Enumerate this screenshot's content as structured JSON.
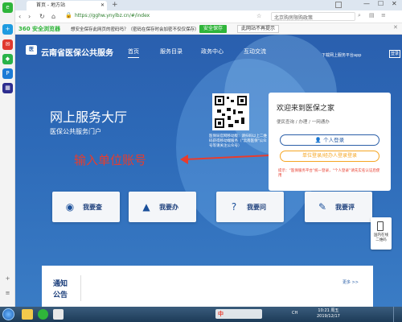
{
  "browser": {
    "tab_title": "首页 - 地方站",
    "new_tab": "+",
    "url": "https://gghw.ynylbz.cn/#/index",
    "search_placeholder": "北京购房限购政策",
    "brand": "360 安全浏览器",
    "infobar_text": "想安全保存此网页的密码吗？（密码在保存时会加密不仅仅保存）",
    "save_btn": "安全保存",
    "nosave_btn": "此网站不再提示",
    "win_min": "—",
    "win_max": "☐",
    "win_close": "✕"
  },
  "site": {
    "logo_text": "云南省医保公共服务",
    "nav": [
      "首页",
      "服务目录",
      "政务中心",
      "互动交流"
    ],
    "app_download": "下载网上服务平台app",
    "login_short": "登录",
    "hero_title": "网上服务大厅",
    "hero_sub": "医保公共服务门户",
    "qr_caption": "医保局官网移动版：请扫码以上二维码获得移动端服务（\"云南医保\"公众号等请关注公众号）",
    "annotation": "输入单位账号",
    "welcome_title": "欢迎来到医保之家",
    "welcome_sub": "便民查询 / 办理 / 一网通办",
    "personal_login": "个人登录",
    "unit_login": "单位登录/经办人登录登录",
    "hint": "提示：“医保服务平台”统一登录，“个人登录”请先实名认证后使用"
  },
  "services": [
    {
      "label": "我要查",
      "icon": "eye-icon"
    },
    {
      "label": "我要办",
      "icon": "stamp-icon"
    },
    {
      "label": "我要问",
      "icon": "question-icon"
    },
    {
      "label": "我要评",
      "icon": "comment-icon"
    }
  ],
  "side_float": {
    "label": "国内在线二维码"
  },
  "notice": {
    "title1": "通知",
    "title2": "公告",
    "more": "更多 >>"
  },
  "status": {
    "ime": "中",
    "time": "10:21 周五",
    "date": "2019/12/17",
    "lang": "CH"
  },
  "colors": {
    "brand_blue": "#2b5fa8",
    "accent_red": "#e83c2d",
    "orange": "#f5a623",
    "green": "#2fb53a"
  }
}
